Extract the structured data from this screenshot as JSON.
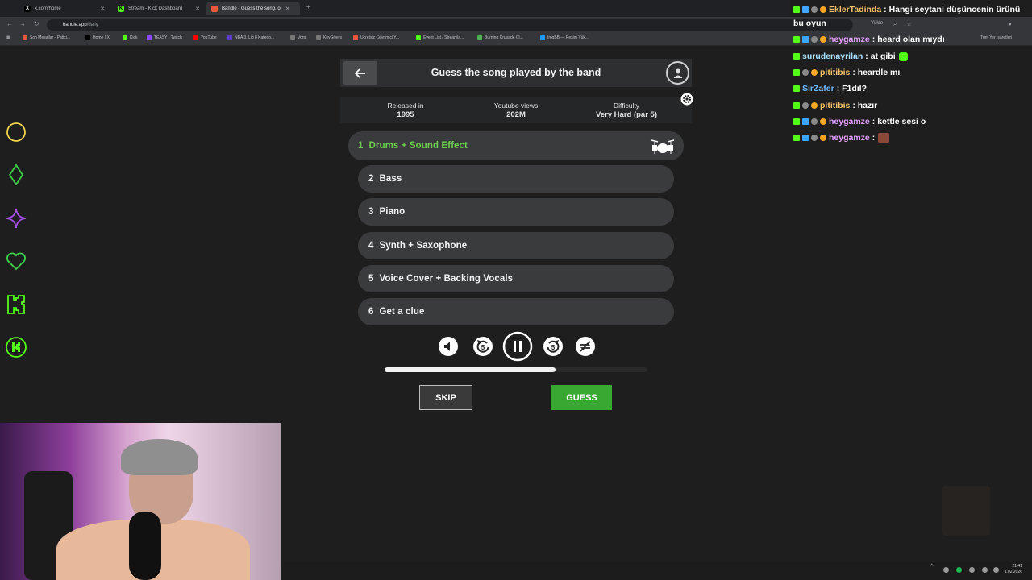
{
  "browser": {
    "tabs": [
      {
        "label": "x.com/home",
        "icon": "x-logo-icon",
        "active": false
      },
      {
        "label": "Stream - Kick Dashboard",
        "icon": "kick-logo-icon",
        "active": false
      },
      {
        "label": "Bandle - Guess the song, o",
        "icon": "bandle-logo-icon",
        "active": true
      }
    ],
    "url_domain": "bandle.app",
    "url_path": "/daily",
    "bookmarks": [
      "Son Mesajlar - Patici...",
      "Home / X",
      "Kick",
      "TEASY - Twitch",
      "YouTube",
      "NBA 3. Lig 8 Katego...",
      "Vorp",
      "KeyGivers",
      "Ücretsiz Çevrimiçi Y...",
      "Event List / Streamla...",
      "Burning Crusade Cl...",
      "ImgBB — Resim Yük..."
    ],
    "toolbar_right": [
      "Yükle"
    ],
    "all_bookmarks": "Tüm Yer İşaretleri"
  },
  "game": {
    "title": "Guess the song played by the band",
    "info": [
      {
        "label": "Released in",
        "value": "1995"
      },
      {
        "label": "Youtube views",
        "value": "202M"
      },
      {
        "label": "Difficulty",
        "value": "Very Hard (par 5)"
      }
    ],
    "rows": [
      {
        "num": "1",
        "label": "Drums + Sound Effect",
        "active": true
      },
      {
        "num": "2",
        "label": "Bass",
        "active": false
      },
      {
        "num": "3",
        "label": "Piano",
        "active": false
      },
      {
        "num": "4",
        "label": "Synth + Saxophone",
        "active": false
      },
      {
        "num": "5",
        "label": "Voice Cover + Backing Vocals",
        "active": false
      },
      {
        "num": "6",
        "label": "Get a clue",
        "active": false
      }
    ],
    "controls": {
      "rewind_seconds": "5",
      "forward_seconds": "5"
    },
    "progress": 0.65,
    "skip_label": "SKIP",
    "guess_label": "GUESS",
    "colors": {
      "accent_green": "#38a832",
      "active_row_text": "#6ccf4e"
    }
  },
  "chat": [
    {
      "name": "EklerTadinda",
      "name_color": "#f5c26b",
      "text": ": Hangi seytani düşüncenin ürünü"
    },
    {
      "name": "",
      "name_color": "#ffffff",
      "text": "bu oyun"
    },
    {
      "name": "heygamze",
      "name_color": "#e6a0ff",
      "text": ": heard olan mıydı"
    },
    {
      "name": "surudenayrilan",
      "name_color": "#a8e0ff",
      "text": ": at gibi"
    },
    {
      "name": "pititibis",
      "name_color": "#f5c26b",
      "text": ": heardle mı"
    },
    {
      "name": "SirZafer",
      "name_color": "#6fb9ff",
      "text": ": F1dıl?"
    },
    {
      "name": "pititibis",
      "name_color": "#f5c26b",
      "text": ": hazır"
    },
    {
      "name": "heygamze",
      "name_color": "#e6a0ff",
      "text": ": kettle sesi o"
    },
    {
      "name": "heygamze",
      "name_color": "#e6a0ff",
      "text": ":"
    }
  ],
  "clock": {
    "time": "21:41",
    "date": "1.02.2026"
  }
}
